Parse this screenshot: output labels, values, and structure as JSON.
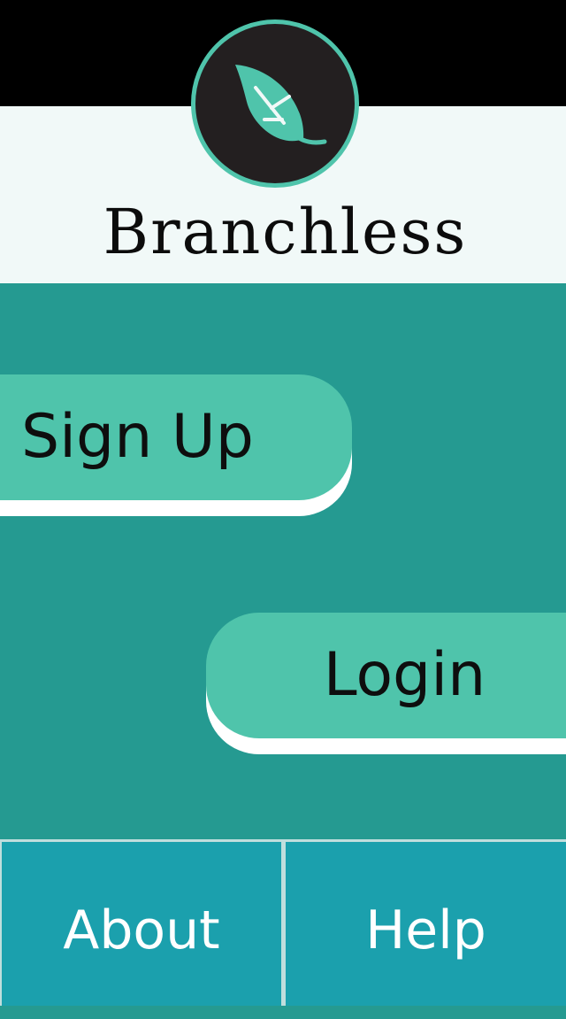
{
  "app": {
    "name": "Branchless",
    "logo_icon": "leaf-icon"
  },
  "colors": {
    "status_bar": "#000000",
    "header_bg": "#f1f9f8",
    "main_bg": "#259a91",
    "button_bg": "#4fc4ab",
    "button_shadow": "#ffffff",
    "footer_bg": "#1ba0ad",
    "logo_bg": "#231f20"
  },
  "actions": {
    "signup_label": "Sign Up",
    "login_label": "Login"
  },
  "footer": {
    "about_label": "About",
    "help_label": "Help"
  }
}
